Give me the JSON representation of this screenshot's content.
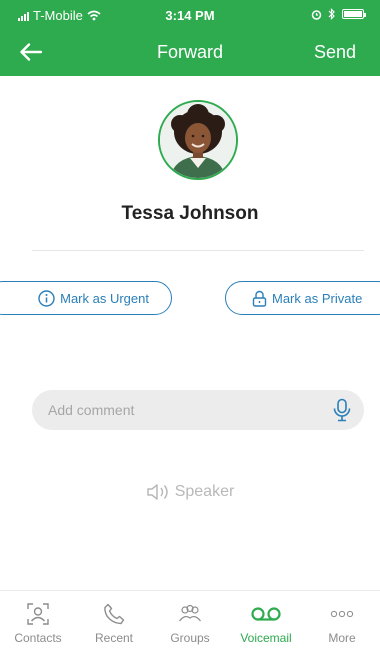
{
  "status_bar": {
    "carrier": "T-Mobile",
    "time": "3:14 PM"
  },
  "nav": {
    "title": "Forward",
    "send_label": "Send"
  },
  "contact": {
    "name": "Tessa Johnson"
  },
  "actions": {
    "urgent_label": "Mark as Urgent",
    "private_label": "Mark as Private"
  },
  "comment": {
    "placeholder": "Add comment",
    "value": ""
  },
  "speaker": {
    "label": "Speaker"
  },
  "tabs": [
    {
      "label": "Contacts",
      "icon": "contacts-icon",
      "active": false
    },
    {
      "label": "Recent",
      "icon": "phone-icon",
      "active": false
    },
    {
      "label": "Groups",
      "icon": "groups-icon",
      "active": false
    },
    {
      "label": "Voicemail",
      "icon": "voicemail-icon",
      "active": true
    },
    {
      "label": "More",
      "icon": "more-icon",
      "active": false
    }
  ],
  "colors": {
    "brand_green": "#2eaa4f",
    "action_blue": "#2a7fb8"
  }
}
